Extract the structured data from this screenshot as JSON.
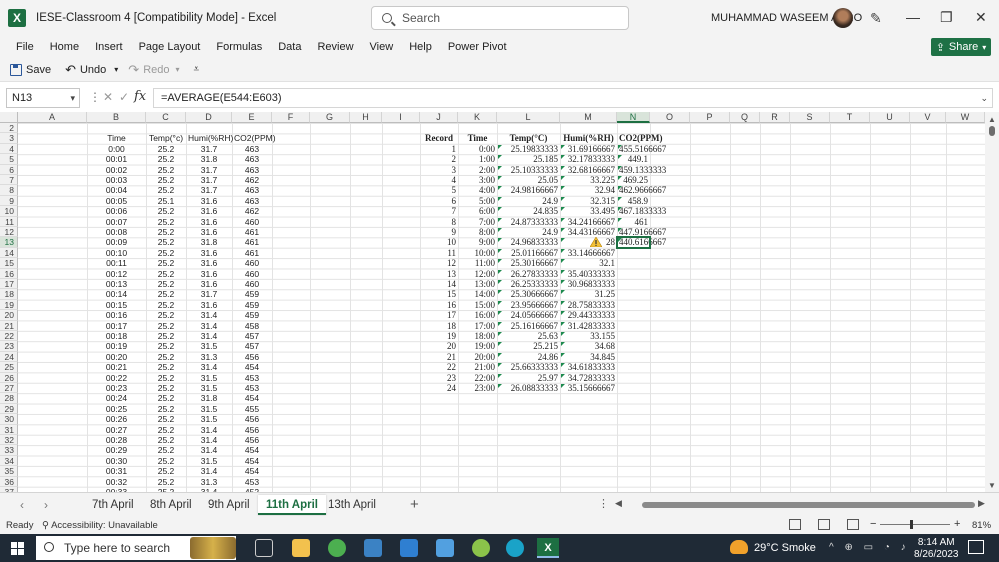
{
  "window": {
    "title": "IESE-Classroom 4  [Compatibility Mode]  -  Excel",
    "search_placeholder": "Search",
    "user_name": "MUHAMMAD WASEEM ABRO",
    "logo": "X"
  },
  "ribbon": {
    "tabs": [
      "File",
      "Home",
      "Insert",
      "Page Layout",
      "Formulas",
      "Data",
      "Review",
      "View",
      "Help",
      "Power Pivot"
    ],
    "share_label": "Share"
  },
  "qat": {
    "save": "Save",
    "undo": "Undo",
    "redo": "Redo"
  },
  "formula_bar": {
    "name_box": "N13",
    "formula": "=AVERAGE(E544:E603)",
    "fx": "fx"
  },
  "grid": {
    "columns": [
      "A",
      "B",
      "C",
      "D",
      "E",
      "F",
      "G",
      "H",
      "I",
      "J",
      "K",
      "L",
      "M",
      "N",
      "O",
      "P",
      "Q",
      "R",
      "S",
      "T",
      "U",
      "V",
      "W"
    ],
    "rows": [
      "2",
      "3",
      "4",
      "5",
      "6",
      "7",
      "8",
      "9",
      "10",
      "11",
      "12",
      "13",
      "14",
      "15",
      "16",
      "17",
      "18",
      "19",
      "20",
      "21",
      "22",
      "23",
      "24",
      "25",
      "26",
      "27",
      "28",
      "29",
      "30",
      "31",
      "32",
      "33",
      "34",
      "35",
      "36",
      "37"
    ],
    "selected_column": "N",
    "selected_row": "13",
    "left_headers": [
      "Time",
      "Temp(°c)",
      "Humi(%RH)",
      "CO2(PPM)"
    ],
    "left_rows": [
      [
        "0:00",
        "25.2",
        "31.7",
        "463"
      ],
      [
        "00:01",
        "25.2",
        "31.8",
        "463"
      ],
      [
        "00:02",
        "25.2",
        "31.7",
        "463"
      ],
      [
        "00:03",
        "25.2",
        "31.7",
        "462"
      ],
      [
        "00:04",
        "25.2",
        "31.7",
        "463"
      ],
      [
        "00:05",
        "25.1",
        "31.6",
        "463"
      ],
      [
        "00:06",
        "25.2",
        "31.6",
        "462"
      ],
      [
        "00:07",
        "25.2",
        "31.6",
        "460"
      ],
      [
        "00:08",
        "25.2",
        "31.6",
        "461"
      ],
      [
        "00:09",
        "25.2",
        "31.8",
        "461"
      ],
      [
        "00:10",
        "25.2",
        "31.6",
        "461"
      ],
      [
        "00:11",
        "25.2",
        "31.6",
        "460"
      ],
      [
        "00:12",
        "25.2",
        "31.6",
        "460"
      ],
      [
        "00:13",
        "25.2",
        "31.6",
        "460"
      ],
      [
        "00:14",
        "25.2",
        "31.7",
        "459"
      ],
      [
        "00:15",
        "25.2",
        "31.6",
        "459"
      ],
      [
        "00:16",
        "25.2",
        "31.4",
        "459"
      ],
      [
        "00:17",
        "25.2",
        "31.4",
        "458"
      ],
      [
        "00:18",
        "25.2",
        "31.4",
        "457"
      ],
      [
        "00:19",
        "25.2",
        "31.5",
        "457"
      ],
      [
        "00:20",
        "25.2",
        "31.3",
        "456"
      ],
      [
        "00:21",
        "25.2",
        "31.4",
        "454"
      ],
      [
        "00:22",
        "25.2",
        "31.5",
        "453"
      ],
      [
        "00:23",
        "25.2",
        "31.5",
        "453"
      ],
      [
        "00:24",
        "25.2",
        "31.8",
        "454"
      ],
      [
        "00:25",
        "25.2",
        "31.5",
        "455"
      ],
      [
        "00:26",
        "25.2",
        "31.5",
        "456"
      ],
      [
        "00:27",
        "25.2",
        "31.4",
        "456"
      ],
      [
        "00:28",
        "25.2",
        "31.4",
        "456"
      ],
      [
        "00:29",
        "25.2",
        "31.4",
        "454"
      ],
      [
        "00:30",
        "25.2",
        "31.5",
        "454"
      ],
      [
        "00:31",
        "25.2",
        "31.4",
        "454"
      ],
      [
        "00:32",
        "25.2",
        "31.3",
        "453"
      ],
      [
        "00:33",
        "25.2",
        "31.4",
        "452"
      ]
    ],
    "right_headers": [
      "Record",
      "Time",
      "Temp(°C)",
      "Humi(%RH)",
      "CO2(PPM)"
    ],
    "right_rows": [
      [
        "1",
        "0:00",
        "25.19833333",
        "31.69166667",
        "455.5166667"
      ],
      [
        "2",
        "1:00",
        "25.185",
        "32.17833333",
        "449.1"
      ],
      [
        "3",
        "2:00",
        "25.10333333",
        "32.68166667",
        "459.1333333"
      ],
      [
        "4",
        "3:00",
        "25.05",
        "33.225",
        "469.25"
      ],
      [
        "5",
        "4:00",
        "24.98166667",
        "32.94",
        "462.9666667"
      ],
      [
        "6",
        "5:00",
        "24.9",
        "32.315",
        "458.9"
      ],
      [
        "7",
        "6:00",
        "24.835",
        "33.495",
        "467.1833333"
      ],
      [
        "8",
        "7:00",
        "24.87333333",
        "34.24166667",
        "461"
      ],
      [
        "9",
        "8:00",
        "24.9",
        "34.43166667",
        "447.9166667"
      ],
      [
        "10",
        "9:00",
        "24.96833333",
        "28",
        "440.6166667"
      ],
      [
        "11",
        "10:00",
        "25.01166667",
        "33.14666667",
        ""
      ],
      [
        "12",
        "11:00",
        "25.30166667",
        "32.1",
        ""
      ],
      [
        "13",
        "12:00",
        "26.27833333",
        "35.40333333",
        ""
      ],
      [
        "14",
        "13:00",
        "26.25333333",
        "30.96833333",
        ""
      ],
      [
        "15",
        "14:00",
        "25.30666667",
        "31.25",
        ""
      ],
      [
        "16",
        "15:00",
        "23.95666667",
        "28.75833333",
        ""
      ],
      [
        "17",
        "16:00",
        "24.05666667",
        "29.44333333",
        ""
      ],
      [
        "18",
        "17:00",
        "25.16166667",
        "31.42833333",
        ""
      ],
      [
        "19",
        "18:00",
        "25.63",
        "33.155",
        ""
      ],
      [
        "20",
        "19:00",
        "25.215",
        "34.68",
        ""
      ],
      [
        "21",
        "20:00",
        "24.86",
        "34.845",
        ""
      ],
      [
        "22",
        "21:00",
        "25.66333333",
        "34.61833333",
        ""
      ],
      [
        "23",
        "22:00",
        "25.97",
        "34.72833333",
        ""
      ],
      [
        "24",
        "23:00",
        "26.08833333",
        "35.15666667",
        ""
      ]
    ]
  },
  "sheets": {
    "tabs": [
      "7th April",
      "8th April",
      "9th April",
      "11th April",
      "13th April"
    ],
    "active": "11th April"
  },
  "status": {
    "ready": "Ready",
    "accessibility": "Accessibility: Unavailable",
    "zoom": "81%"
  },
  "taskbar": {
    "search_placeholder": "Type here to search",
    "weather": "29°C  Smoke",
    "time": "8:14 AM",
    "date": "8/26/2023",
    "excel_label": "X"
  },
  "colors": {
    "excel_green": "#1d6f42",
    "taskbar_bg": "#1f2a36"
  }
}
